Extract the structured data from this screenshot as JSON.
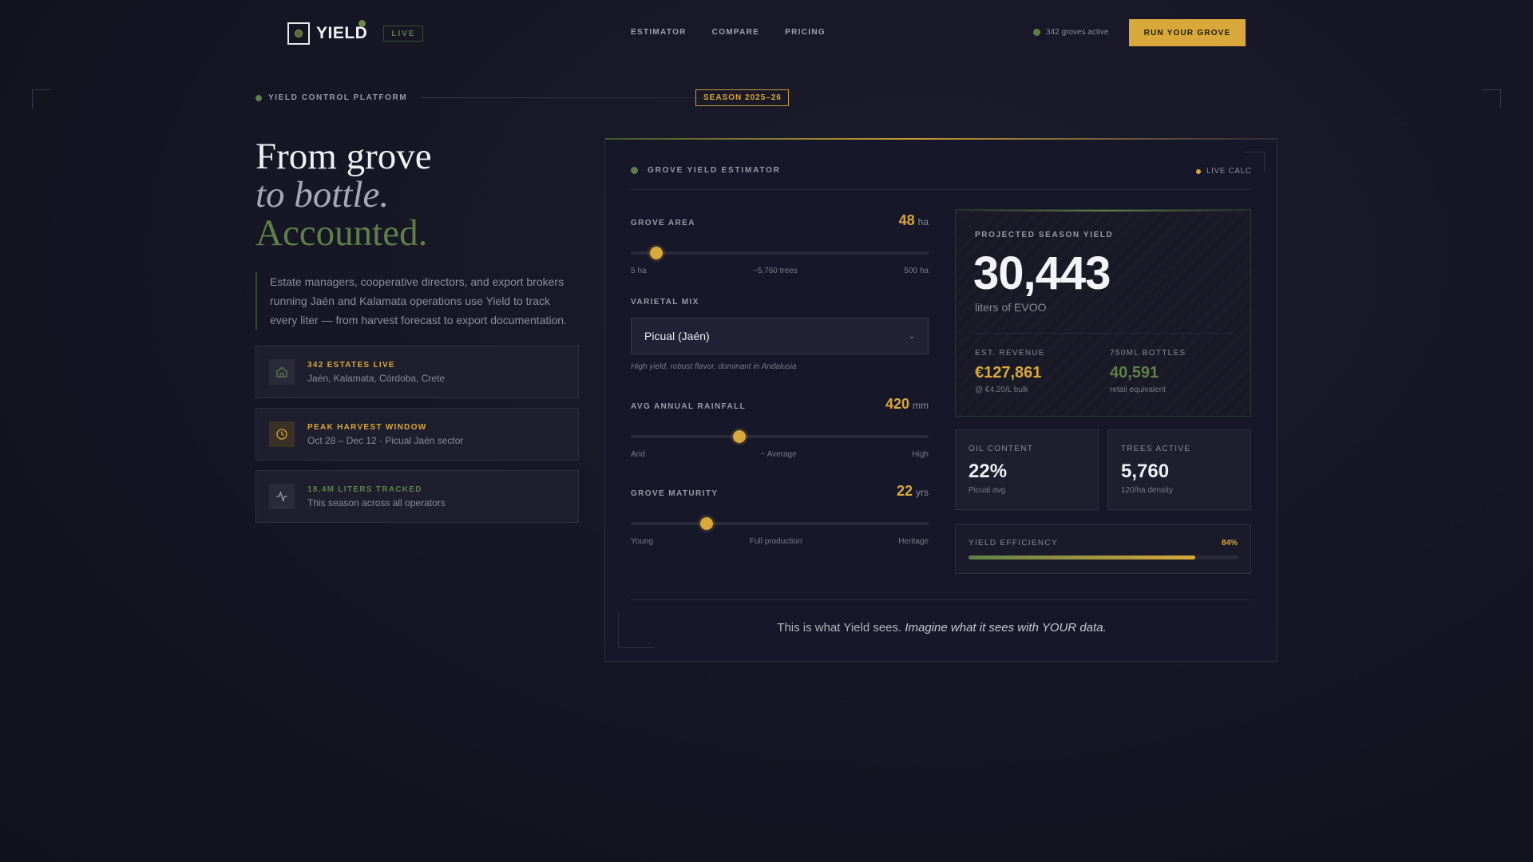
{
  "nav": {
    "logo": "YIELD",
    "live": "LIVE",
    "links": [
      "ESTIMATOR",
      "COMPARE",
      "PRICING"
    ],
    "groves_active": "342 groves active",
    "cta": "RUN YOUR GROVE"
  },
  "platform": {
    "label": "YIELD CONTROL PLATFORM",
    "season": "SEASON 2025–26"
  },
  "hero": {
    "line1": "From grove",
    "line2": "to bottle.",
    "line3": "Accounted.",
    "description": "Estate managers, cooperative directors, and export brokers running Jaén and Kalamata operations use Yield to track every liter — from harvest forecast to export documentation."
  },
  "info_cards": [
    {
      "title": "342 ESTATES LIVE",
      "sub": "Jaén, Kalamata, Córdoba, Crete",
      "icon": "home-icon",
      "color": "#d9a83a"
    },
    {
      "title": "PEAK HARVEST WINDOW",
      "sub": "Oct 28 – Dec 12 · Picual Jaén sector",
      "icon": "clock-icon",
      "color": "#d9a83a"
    },
    {
      "title": "18.4M LITERS TRACKED",
      "sub": "This season across all operators",
      "icon": "activity-icon",
      "color": "#5e8048"
    }
  ],
  "estimator": {
    "title": "GROVE YIELD ESTIMATOR",
    "live_calc": "LIVE CALC",
    "grove_area": {
      "label": "GROVE AREA",
      "value": "48",
      "unit": "ha",
      "fraction": 0.087,
      "ticks": [
        "5 ha",
        "~5,760 trees",
        "500 ha"
      ]
    },
    "varietal": {
      "label": "VARIETAL MIX",
      "selected": "Picual (Jaén)",
      "note": "High yield, robust flavor, dominant in Andalusia"
    },
    "rainfall": {
      "label": "AVG ANNUAL RAINFALL",
      "value": "420",
      "unit": "mm",
      "fraction": 0.365,
      "ticks": [
        "Arid",
        "~ Average",
        "High"
      ]
    },
    "maturity": {
      "label": "GROVE MATURITY",
      "value": "22",
      "unit": "yrs",
      "fraction": 0.255,
      "ticks": [
        "Young",
        "Full production",
        "Heritage"
      ]
    },
    "result": {
      "label": "PROJECTED SEASON YIELD",
      "value": "30,443",
      "unit": "liters of EVOO",
      "revenue": {
        "label": "EST. REVENUE",
        "value": "€127,861",
        "note": "@ €4.20/L bulk"
      },
      "bottles": {
        "label": "750ML BOTTLES",
        "value": "40,591",
        "note": "retail equivalent"
      }
    },
    "oil": {
      "label": "OIL CONTENT",
      "value": "22%",
      "note": "Picual avg"
    },
    "trees": {
      "label": "TREES ACTIVE",
      "value": "5,760",
      "note": "120/ha density"
    },
    "efficiency": {
      "label": "YIELD EFFICIENCY",
      "value": "84%",
      "fraction": 0.84
    },
    "tagline_plain": "This is what Yield sees. ",
    "tagline_italic": "Imagine what it sees with YOUR data."
  },
  "colors": {
    "accent": "#d9a83a",
    "olive": "#5e8048",
    "background": "#161625"
  }
}
